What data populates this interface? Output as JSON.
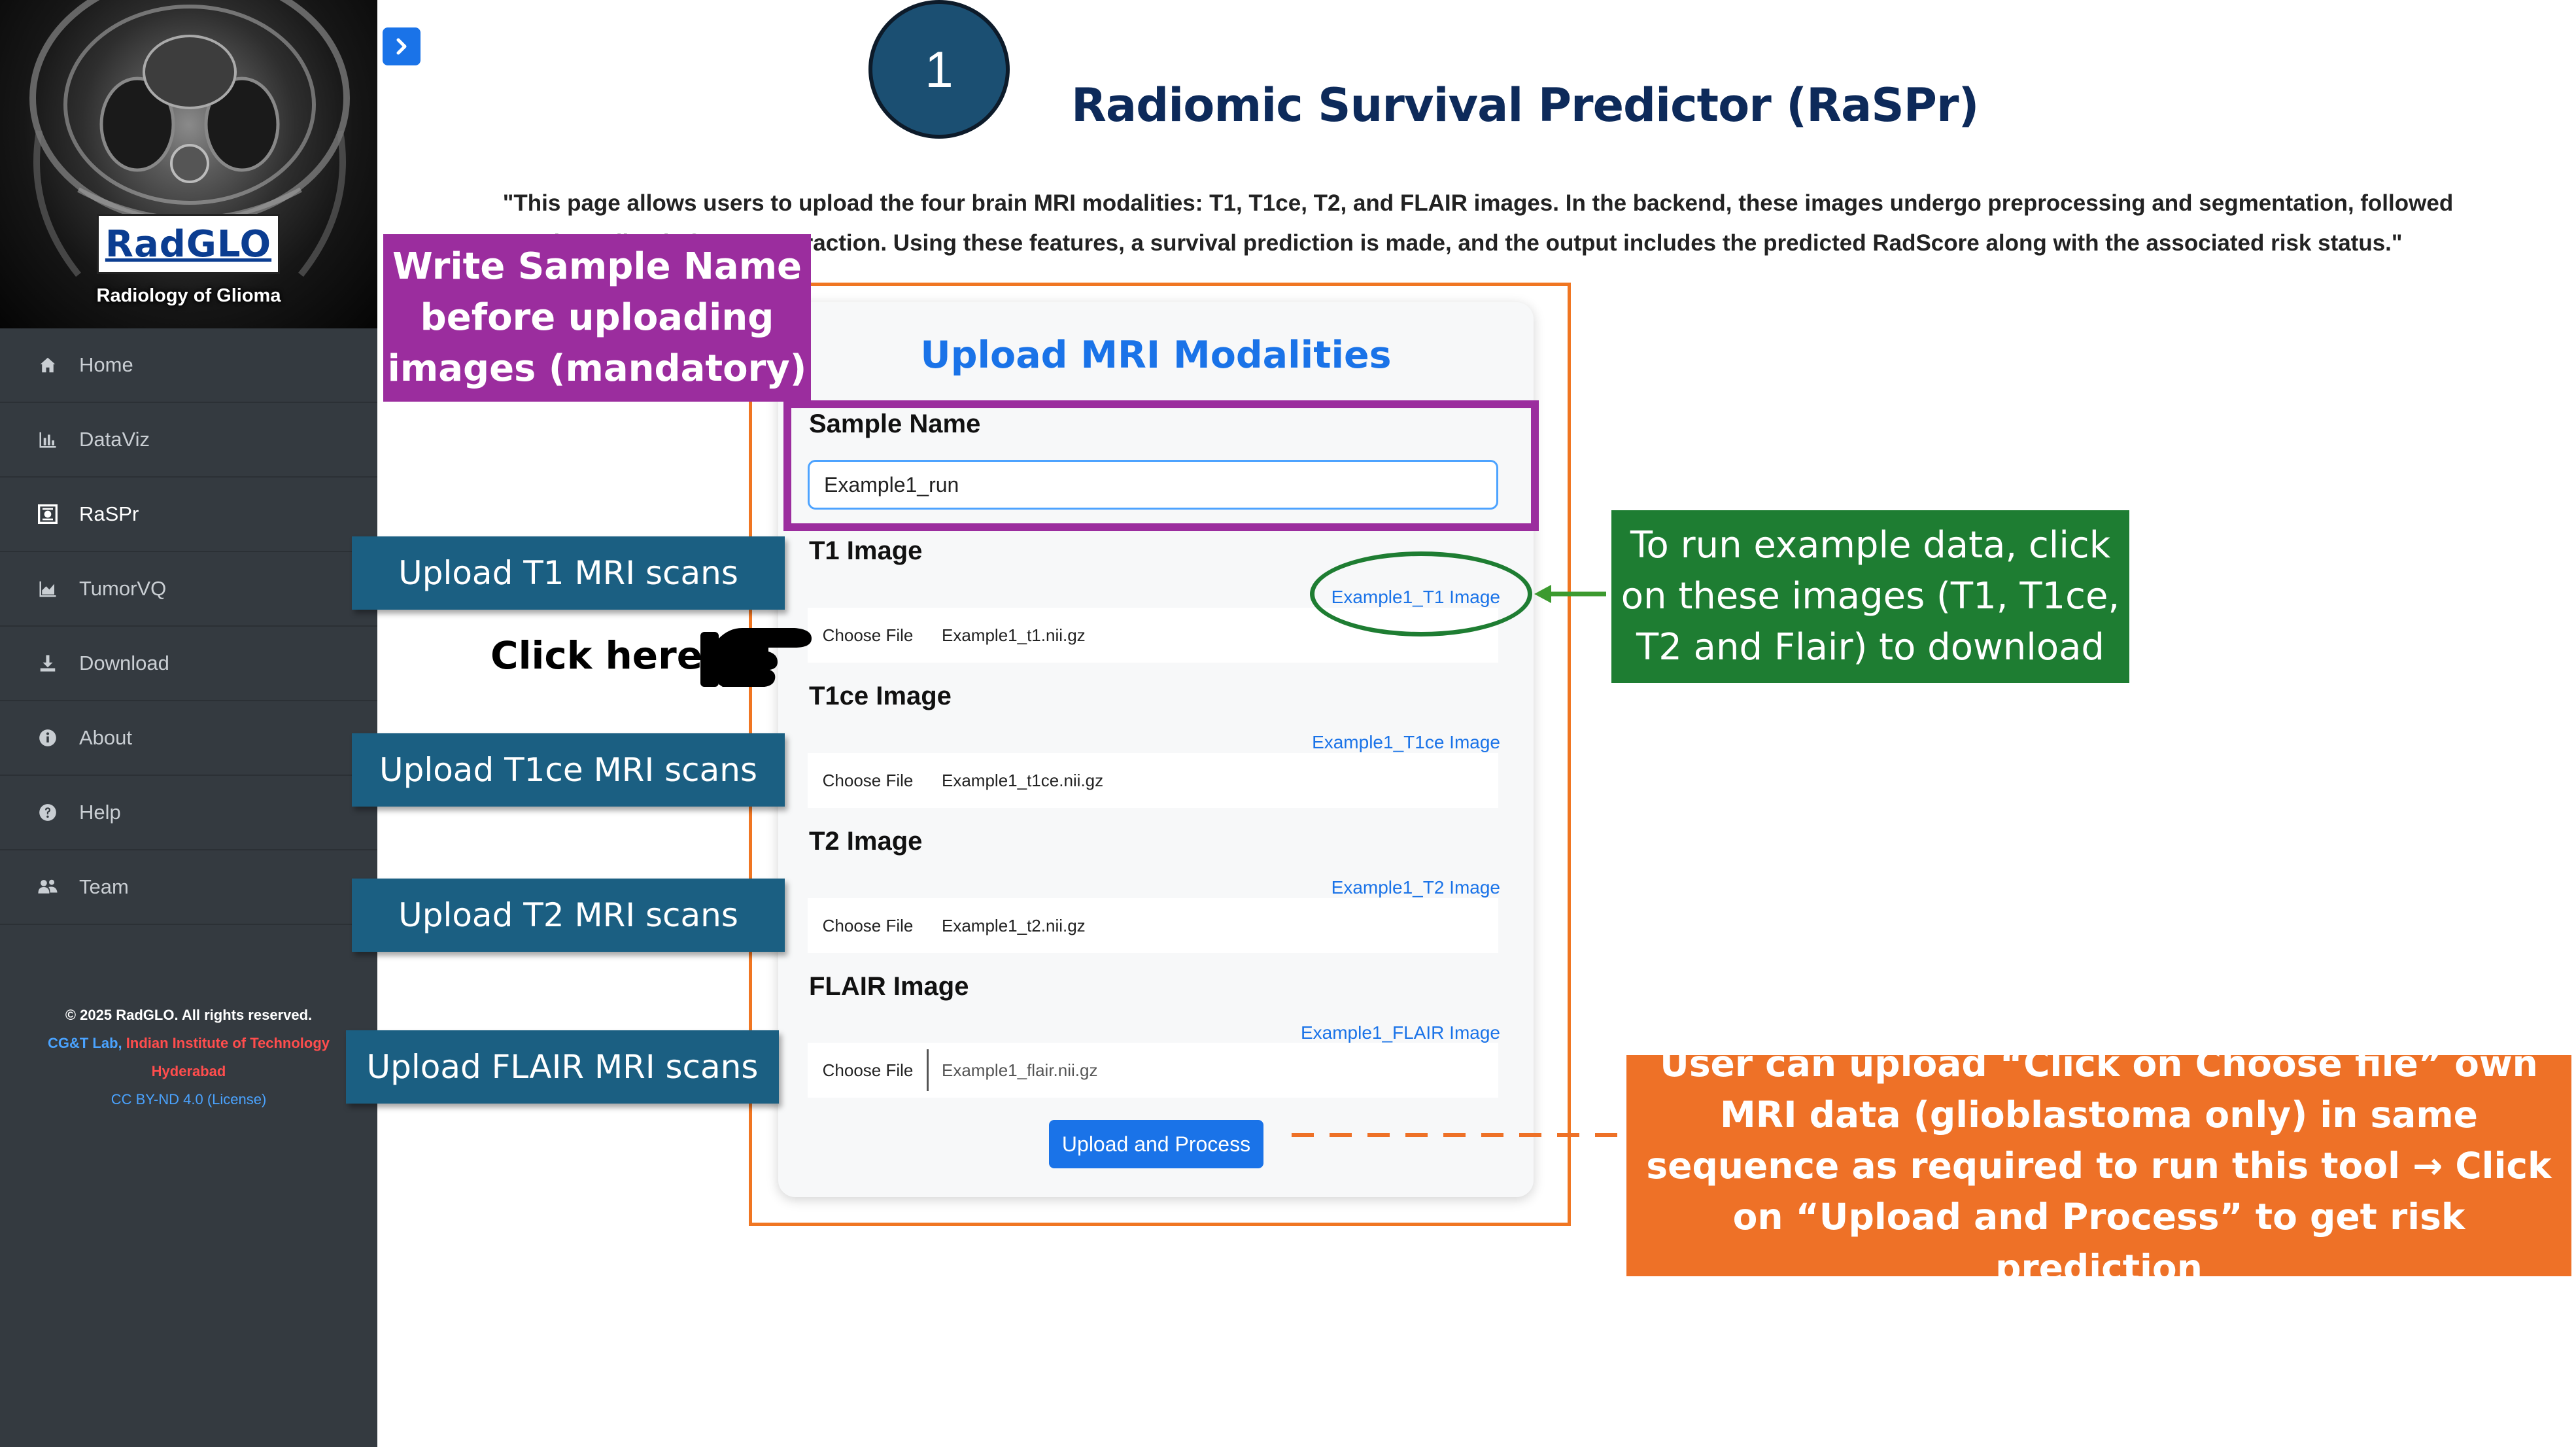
{
  "sidebar": {
    "logo_text": "RadGLO",
    "logo_subtitle": "Radiology of Glioma",
    "items": [
      {
        "label": "Home",
        "icon": "home-icon"
      },
      {
        "label": "DataViz",
        "icon": "bar-chart-icon"
      },
      {
        "label": "RaSPr",
        "icon": "scan-icon",
        "active": true
      },
      {
        "label": "TumorVQ",
        "icon": "area-chart-icon"
      },
      {
        "label": "Download",
        "icon": "download-icon"
      },
      {
        "label": "About",
        "icon": "info-icon"
      },
      {
        "label": "Help",
        "icon": "help-icon"
      },
      {
        "label": "Team",
        "icon": "users-icon"
      }
    ],
    "footer": {
      "copyright": "© 2025 RadGLO. All rights reserved.",
      "lab": "CG&T Lab,",
      "institute": "Indian Institute of Technology",
      "city": "Hyderabad",
      "license": "CC BY-ND 4.0 (License)"
    }
  },
  "header": {
    "step_number": "1",
    "title": "Radiomic Survival Predictor (RaSPr)",
    "description": "\"This page allows users to upload the four brain MRI modalities: T1, T1ce, T2, and FLAIR images. In the backend, these images undergo preprocessing and segmentation, followed by radiomic feature extraction. Using these features, a survival prediction is made, and the output includes the predicted RadScore along with the associated risk status.\""
  },
  "form": {
    "title": "Upload MRI Modalities",
    "sample_name_label": "Sample Name",
    "sample_name_value": "Example1_run",
    "choose_file_label": "Choose File",
    "fields": [
      {
        "label": "T1 Image",
        "link": "Example1_T1 Image",
        "file": "Example1_t1.nii.gz"
      },
      {
        "label": "T1ce Image",
        "link": "Example1_T1ce Image",
        "file": "Example1_t1ce.nii.gz"
      },
      {
        "label": "T2 Image",
        "link": "Example1_T2 Image",
        "file": "Example1_t2.nii.gz"
      },
      {
        "label": "FLAIR Image",
        "link": "Example1_FLAIR Image",
        "file": "Example1_flair.nii.gz"
      }
    ],
    "submit_label": "Upload and Process"
  },
  "annotations": {
    "sample_name_note": "Write Sample Name before uploading images (mandatory)",
    "upload_t1": "Upload T1 MRI scans",
    "upload_t1ce": "Upload T1ce MRI scans",
    "upload_t2": "Upload T2 MRI scans",
    "upload_flair": "Upload FLAIR MRI scans",
    "click_here": "Click here",
    "example_note": "To run example data, click on these images (T1, T1ce, T2 and Flair) to download",
    "process_note": "User can upload “Click on Choose file” own MRI data (glioblastoma only) in same sequence as required to run this tool → Click on “Upload and Process” to get risk prediction"
  },
  "colors": {
    "sidebar_bg": "#343a40",
    "accent_blue": "#1a73e8",
    "title_navy": "#0d2a5a",
    "annotation_purple": "#9b2d9e",
    "annotation_blue": "#1b5f82",
    "annotation_green": "#1e7d32",
    "annotation_orange": "#ee7127"
  }
}
